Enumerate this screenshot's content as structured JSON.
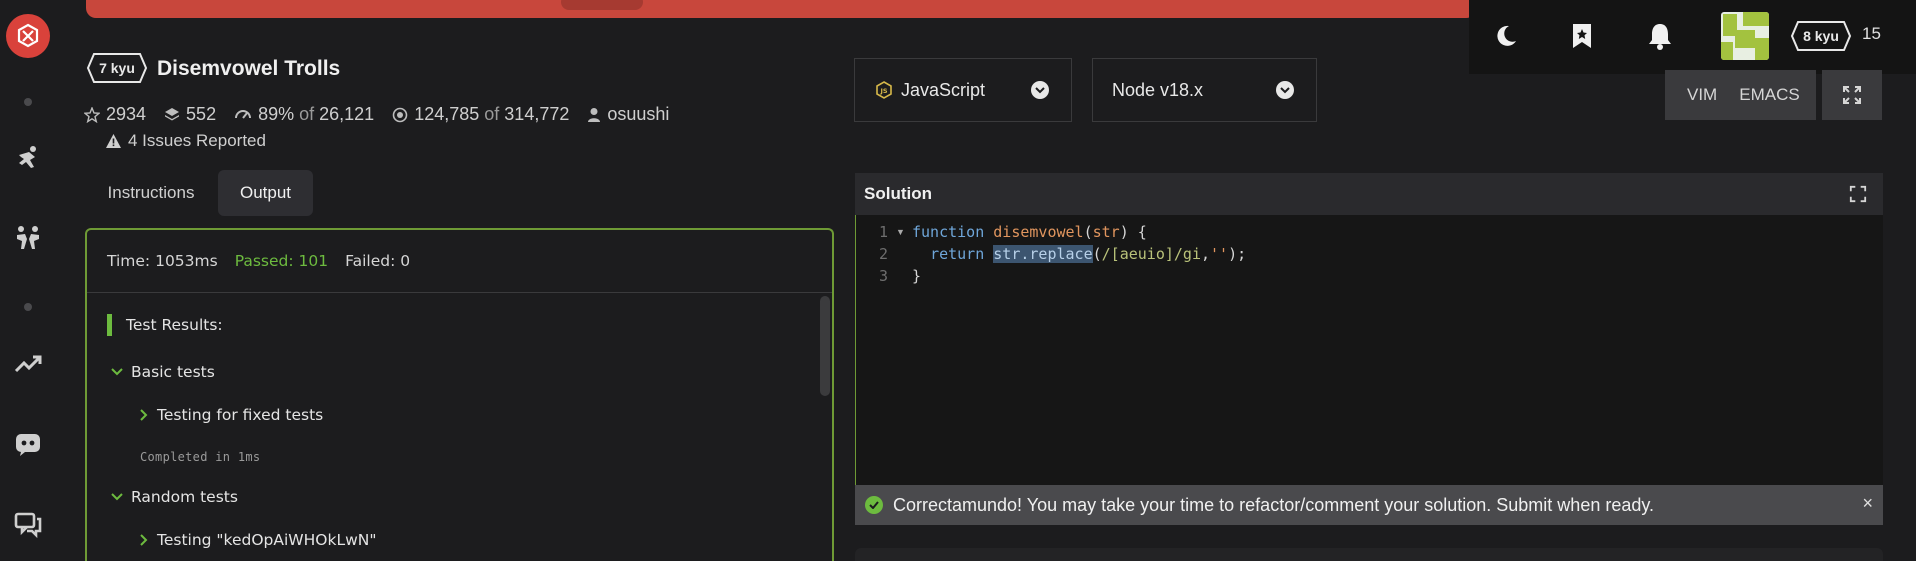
{
  "kata": {
    "rank": "7 kyu",
    "title": "Disemvowel Trolls",
    "stars": "2934",
    "collections": "552",
    "satisfaction": "89%",
    "satisfaction_of": "of",
    "votes": "26,121",
    "completed": "124,785",
    "completed_of": "of",
    "attempted": "314,772",
    "author": "osuushi",
    "issues": "4 Issues Reported"
  },
  "user": {
    "rank": "8 kyu",
    "honor": "15"
  },
  "tabs": [
    {
      "label": "Instructions",
      "active": false
    },
    {
      "label": "Output",
      "active": true
    }
  ],
  "output": {
    "time": "Time: 1053ms",
    "passed": "Passed: 101",
    "failed": "Failed: 0",
    "results_title": "Test Results:",
    "groups": [
      {
        "label": "Basic tests"
      },
      {
        "label": "Testing for fixed tests"
      },
      {
        "label": "Completed in 1ms"
      },
      {
        "label": "Random tests"
      },
      {
        "label": "Testing \"kedOpAiWHOkLwN\""
      }
    ]
  },
  "language": {
    "selected": "JavaScript"
  },
  "runtime": {
    "selected": "Node v18.x"
  },
  "editor_modes": {
    "vim": "VIM",
    "emacs": "EMACS"
  },
  "solution": {
    "title": "Solution",
    "line_numbers": [
      "1",
      "2",
      "3"
    ],
    "code": {
      "l1_kw": "function",
      "l1_fn": "disemvowel",
      "l1_open": "(",
      "l1_param": "str",
      "l1_close": ") {",
      "l2_kw": "return",
      "l2_sel": "str.replace",
      "l2_open": "(",
      "l2_regex": "/[aeuio]/gi",
      "l2_comma": ",",
      "l2_str": "''",
      "l2_end": ");",
      "l3": "}"
    }
  },
  "toast": {
    "message": "Correctamundo! You may take your time to refactor/comment your solution. Submit when ready.",
    "close": "×"
  },
  "colors": {
    "accent_green": "#6dbb3f",
    "brand_red": "#d9423b",
    "panel_border": "#6e9a35"
  }
}
